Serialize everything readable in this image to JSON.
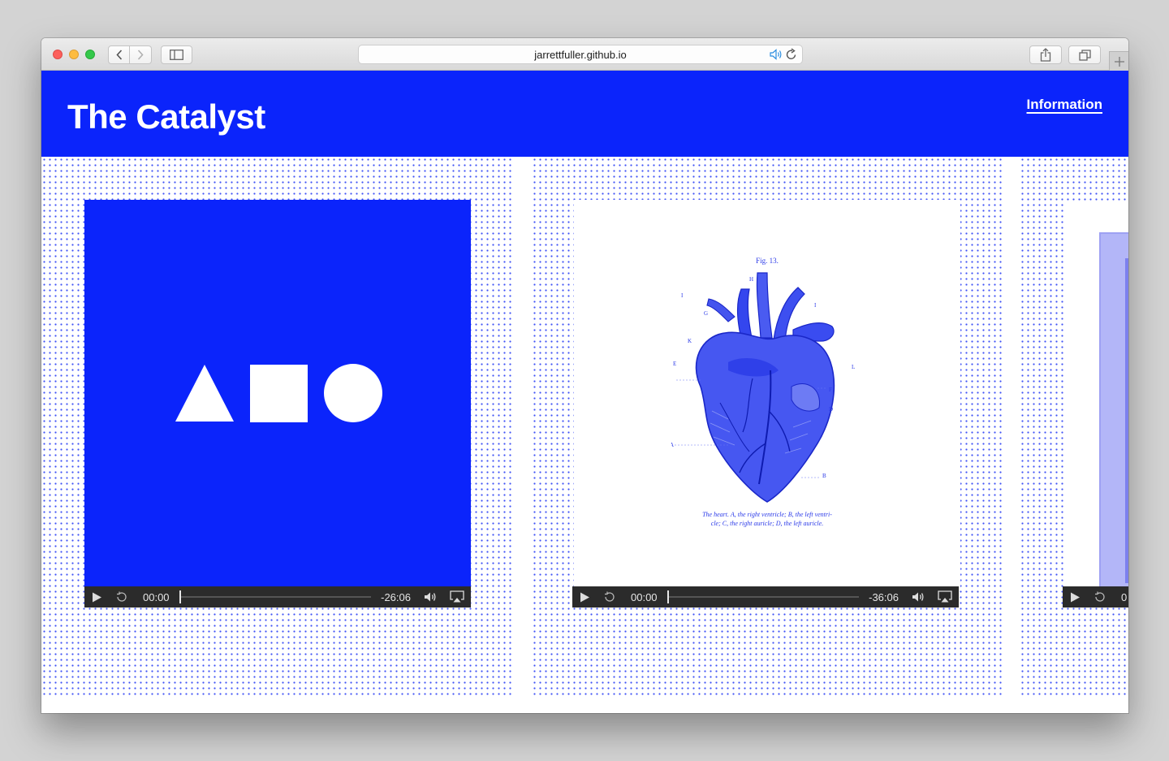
{
  "browser": {
    "url": "jarrettfuller.github.io"
  },
  "site": {
    "title": "The Catalyst",
    "nav_link": "Information",
    "brand_color": "#0b24fb"
  },
  "episodes": [
    {
      "artwork": "shapes-logo",
      "player": {
        "current_time": "00:00",
        "remaining_time": "-26:06"
      }
    },
    {
      "artwork": "anatomical-heart",
      "figure_label": "Fig. 13.",
      "caption_line1": "The heart. A, the right ventricle; B, the left ventri-",
      "caption_line2": "cle; C, the right auricle; D, the left auricle.",
      "player": {
        "current_time": "00:00",
        "remaining_time": "-36:06"
      }
    },
    {
      "artwork": "partial-lilac",
      "player": {
        "current_time": "0"
      }
    }
  ]
}
